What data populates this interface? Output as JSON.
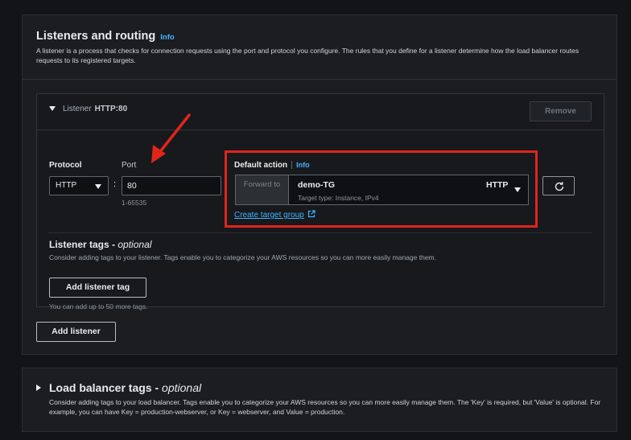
{
  "listeners_section": {
    "title": "Listeners and routing",
    "info": "Info",
    "description": "A listener is a process that checks for connection requests using the port and protocol you configure. The rules that you define for a listener determine how the load balancer routes requests to its registered targets."
  },
  "listener": {
    "label": "Listener",
    "value": "HTTP:80",
    "remove_label": "Remove",
    "protocol_label": "Protocol",
    "protocol_value": "HTTP",
    "port_label": "Port",
    "port_value": "80",
    "port_hint": "1-65535",
    "default_action_label": "Default action",
    "default_action_info": "Info",
    "forward_to": "Forward to",
    "target_group_name": "demo-TG",
    "target_group_protocol": "HTTP",
    "target_group_subtitle": "Target type: Instance, IPv4",
    "create_target_group": "Create target group"
  },
  "listener_tags": {
    "title": "Listener tags -",
    "title_optional": "optional",
    "description": "Consider adding tags to your listener. Tags enable you to categorize your AWS resources so you can more easily manage them.",
    "add_label": "Add listener tag",
    "limit": "You can add up to 50 more tags."
  },
  "add_listener_label": "Add listener",
  "lb_tags": {
    "title": "Load balancer tags -",
    "title_optional": "optional",
    "description": "Consider adding tags to your load balancer. Tags enable you to categorize your AWS resources so you can more easily manage them. The 'Key' is required, but 'Value' is optional. For example, you can have Key = production-webserver, or Key = webserver, and Value = production."
  },
  "colors": {
    "accent": "#42b4ff",
    "annotation": "#e0251b",
    "panel": "#1b1d21"
  }
}
